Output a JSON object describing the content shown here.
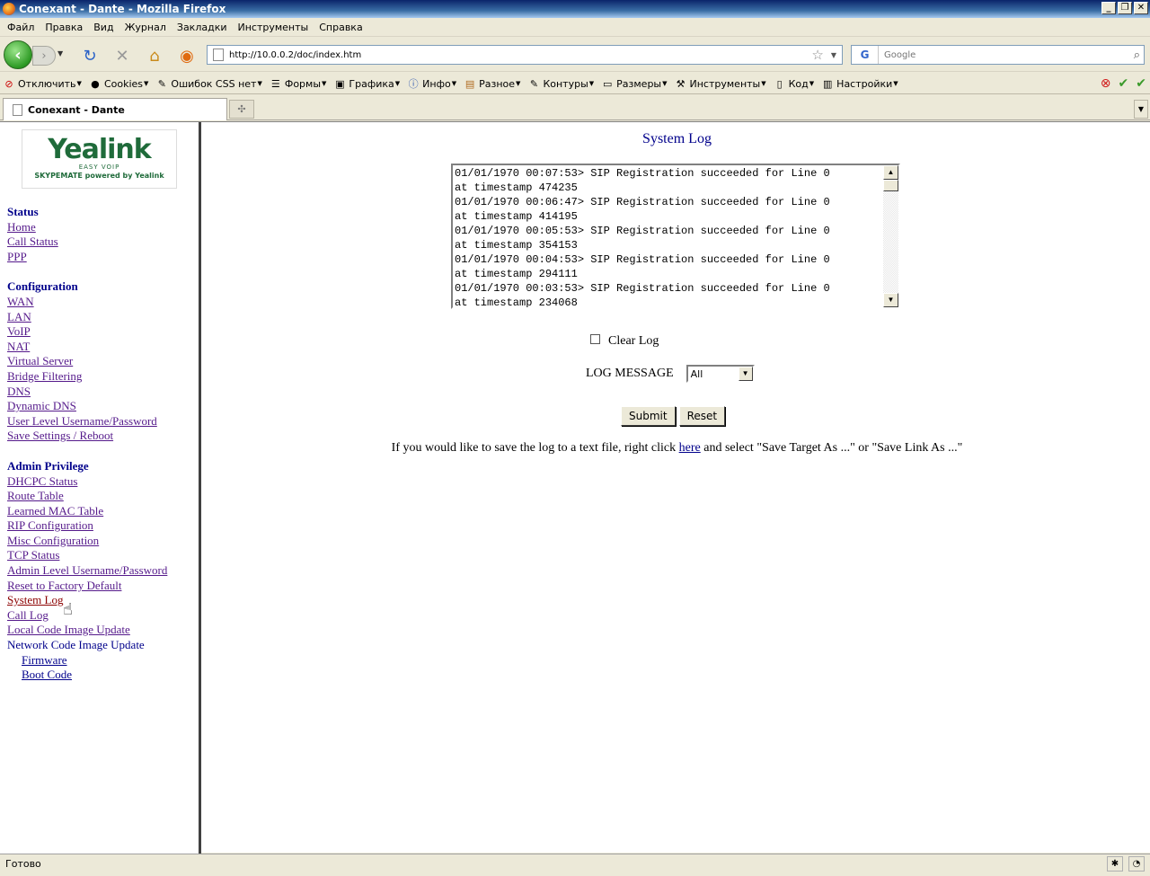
{
  "window": {
    "title": "Conexant - Dante - Mozilla Firefox"
  },
  "menu": [
    "Файл",
    "Правка",
    "Вид",
    "Журнал",
    "Закладки",
    "Инструменты",
    "Справка"
  ],
  "nav": {
    "url": "http://10.0.0.2/doc/index.htm",
    "search_placeholder": "Google"
  },
  "devbar": {
    "items": [
      "Отключить",
      "Cookies",
      "Ошибок CSS нет",
      "Формы",
      "Графика",
      "Инфо",
      "Разное",
      "Контуры",
      "Размеры",
      "Инструменты",
      "Код",
      "Настройки"
    ]
  },
  "tab": {
    "label": "Conexant - Dante"
  },
  "logo": {
    "brand": "Yealink",
    "sub1": "EASY VOIP",
    "sub2": "SKYPEMATE powered by Yealink"
  },
  "sidebar": {
    "status_title": "Status",
    "status_links": [
      "Home",
      "Call Status",
      "PPP"
    ],
    "config_title": "Configuration",
    "config_links": [
      "WAN",
      "LAN",
      "VoIP",
      "NAT",
      "Virtual Server",
      "Bridge Filtering",
      "DNS",
      "Dynamic DNS",
      "User Level Username/Password",
      "Save Settings / Reboot"
    ],
    "admin_title": "Admin Privilege",
    "admin_links": [
      "DHCPC Status",
      "Route Table",
      "Learned MAC Table",
      "RIP Configuration",
      "Misc Configuration",
      "TCP Status",
      "Admin Level Username/Password",
      "Reset to Factory Default",
      "System Log",
      "Call Log",
      "Local Code Image Update"
    ],
    "network_update": "Network Code Image Update",
    "network_sub": [
      "Firmware",
      "Boot Code"
    ]
  },
  "main": {
    "title": "System Log",
    "log_lines": [
      "01/01/1970 00:07:53> SIP Registration succeeded for Line 0",
      "at timestamp 474235",
      "01/01/1970 00:06:47> SIP Registration succeeded for Line 0",
      "at timestamp 414195",
      "01/01/1970 00:05:53> SIP Registration succeeded for Line 0",
      "at timestamp 354153",
      "01/01/1970 00:04:53> SIP Registration succeeded for Line 0",
      "at timestamp 294111",
      "01/01/1970 00:03:53> SIP Registration succeeded for Line 0",
      "at timestamp 234068"
    ],
    "clear_log_label": "Clear Log",
    "log_message_label": "LOG MESSAGE",
    "log_message_value": "All",
    "submit_label": "Submit",
    "reset_label": "Reset",
    "save_text_before": "If you would like to save the log to a text file, right click ",
    "save_link": "here",
    "save_text_after": " and select \"Save Target As ...\" or \"Save Link As ...\""
  },
  "status": {
    "text": "Готово"
  }
}
